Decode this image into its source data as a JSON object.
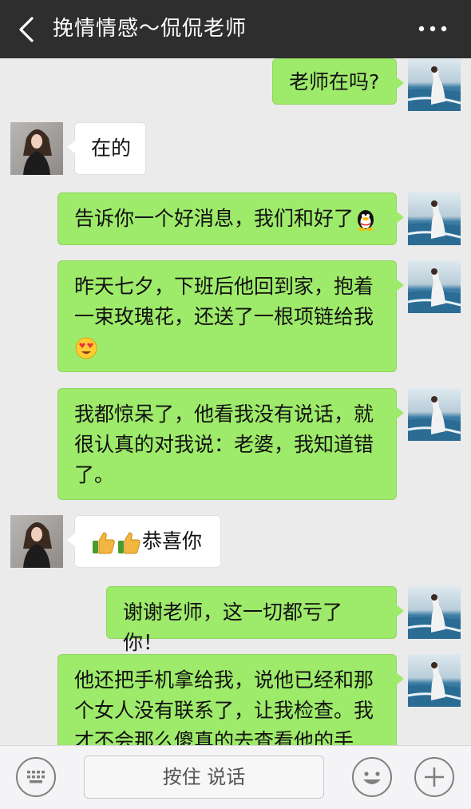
{
  "header": {
    "title": "挽情情感～侃侃老师",
    "back_icon": "chevron-left-icon",
    "more_icon": "more-dots-icon"
  },
  "messages": [
    {
      "side": "right",
      "text": "老师在吗?"
    },
    {
      "side": "left",
      "text": "在的"
    },
    {
      "side": "right",
      "text": "告诉你一个好消息，我们和好了",
      "emoji": "penguin-emoji"
    },
    {
      "side": "right",
      "text_lines": [
        "昨天七夕，下班后他回到家，抱着",
        "一束玫瑰花，还送了一根项链给我"
      ],
      "emoji": "heart-eyes-emoji"
    },
    {
      "side": "right",
      "text_lines": [
        "我都惊呆了，他看我没有说话，就",
        "很认真的对我说：老婆，我知道错",
        "了。"
      ]
    },
    {
      "side": "left",
      "text": "恭喜你",
      "emoji": "thumbs-up-emoji"
    },
    {
      "side": "right",
      "text": "谢谢老师，这一切都亏了你！"
    },
    {
      "side": "right",
      "text_lines": [
        "他还把手机拿给我，说他已经和那",
        "个女人没有联系了，让我检查。我",
        "才不会那么傻真的去查看他的手"
      ]
    }
  ],
  "input_bar": {
    "hold_to_talk": "按住 说话",
    "keyboard_icon": "keyboard-icon",
    "emoji_icon": "smiley-icon",
    "add_icon": "plus-icon"
  },
  "colors": {
    "header_bg": "#2e2e2e",
    "chat_bg": "#ebebeb",
    "sent_bubble": "#9eea6a",
    "received_bubble": "#ffffff"
  }
}
